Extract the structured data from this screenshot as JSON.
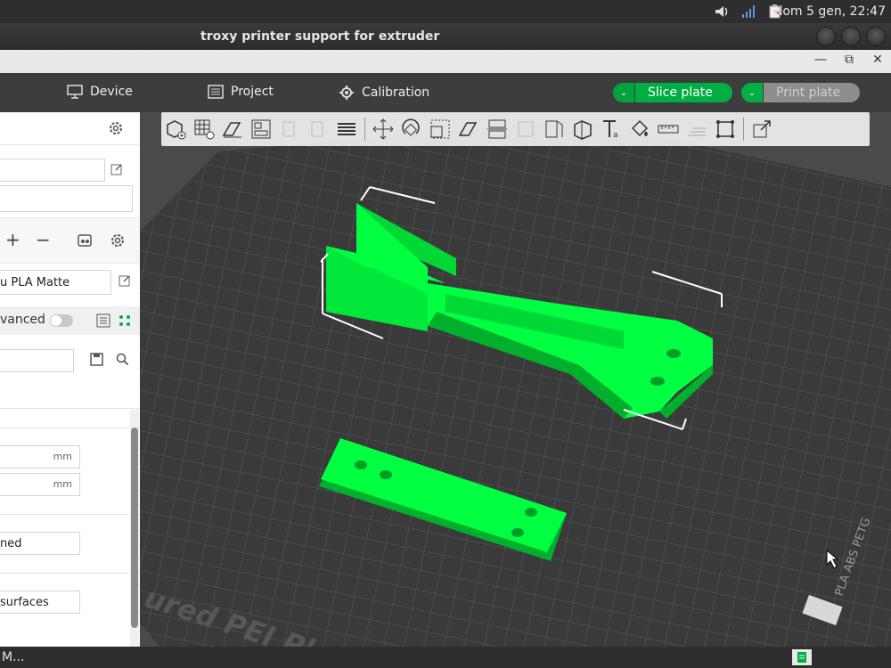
{
  "system_panel": {
    "clock": "dom  5 gen, 22:47",
    "icons": [
      "volume-icon",
      "network-icon",
      "clipboard-icon"
    ]
  },
  "window": {
    "title": "troxy printer support for extruder"
  },
  "app_chrome": {
    "minimize": "—",
    "restore": "⧉",
    "close": "✕"
  },
  "topbar": {
    "tabs": [
      {
        "label": "Device",
        "icon": "device-icon"
      },
      {
        "label": "Project",
        "icon": "project-icon"
      },
      {
        "label": "Calibration",
        "icon": "calibration-icon"
      }
    ],
    "slice_label": "Slice plate",
    "print_label": "Print plate",
    "dropdown_glyph": "⌄"
  },
  "sidebar": {
    "filament_label": "u PLA Matte",
    "advanced_label": "vanced",
    "plus": "+",
    "minus": "−",
    "field_unit_1": "mm",
    "field_unit_2": "mm",
    "select_1": "ned",
    "select_2": "surfaces"
  },
  "viewport": {
    "plate_text": "ured PEI Plate",
    "plate_side_text": "PLA ABS PETG",
    "accent_green": "#00ff40",
    "plate_color": "#3a3a3a"
  },
  "status": {
    "text": "M..."
  },
  "colors": {
    "brand_green": "#00ae42"
  }
}
